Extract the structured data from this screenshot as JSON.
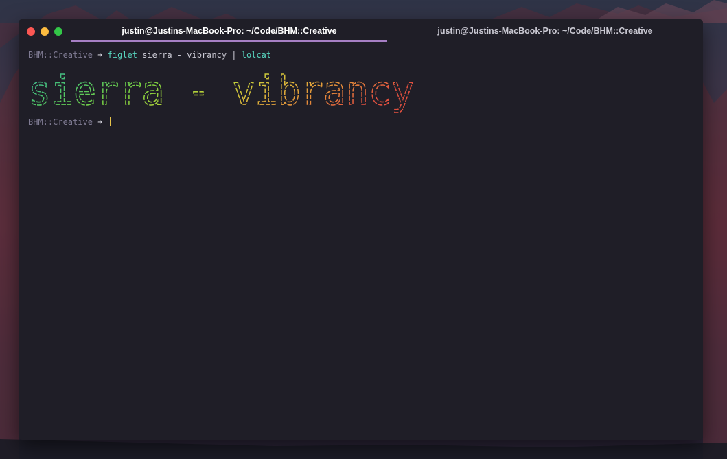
{
  "window": {
    "tabs": [
      {
        "label": "justin@Justins-MacBook-Pro: ~/Code/BHM::Creative",
        "active": true
      },
      {
        "label": "justin@Justins-MacBook-Pro: ~/Code/BHM::Creative",
        "active": false
      }
    ]
  },
  "terminal": {
    "line1": {
      "dir": "BHM::Creative",
      "arrow": "➜",
      "command": "figlet",
      "args": "sierra - vibrancy |",
      "pipe_command": "lolcat"
    },
    "figlet_text": "sierra - vibrancy",
    "line2": {
      "dir": "BHM::Creative",
      "arrow": "➜"
    }
  },
  "colors": {
    "accent_tab": "#a67fc4",
    "prompt_dir": "#7f7b93",
    "command": "#58d6c0",
    "cursor": "#e6c34a",
    "rainbow": [
      "#3fa9a0",
      "#48c26e",
      "#7ad03f",
      "#b8d23a",
      "#e0b63a",
      "#e48a3a",
      "#e0503f"
    ]
  }
}
